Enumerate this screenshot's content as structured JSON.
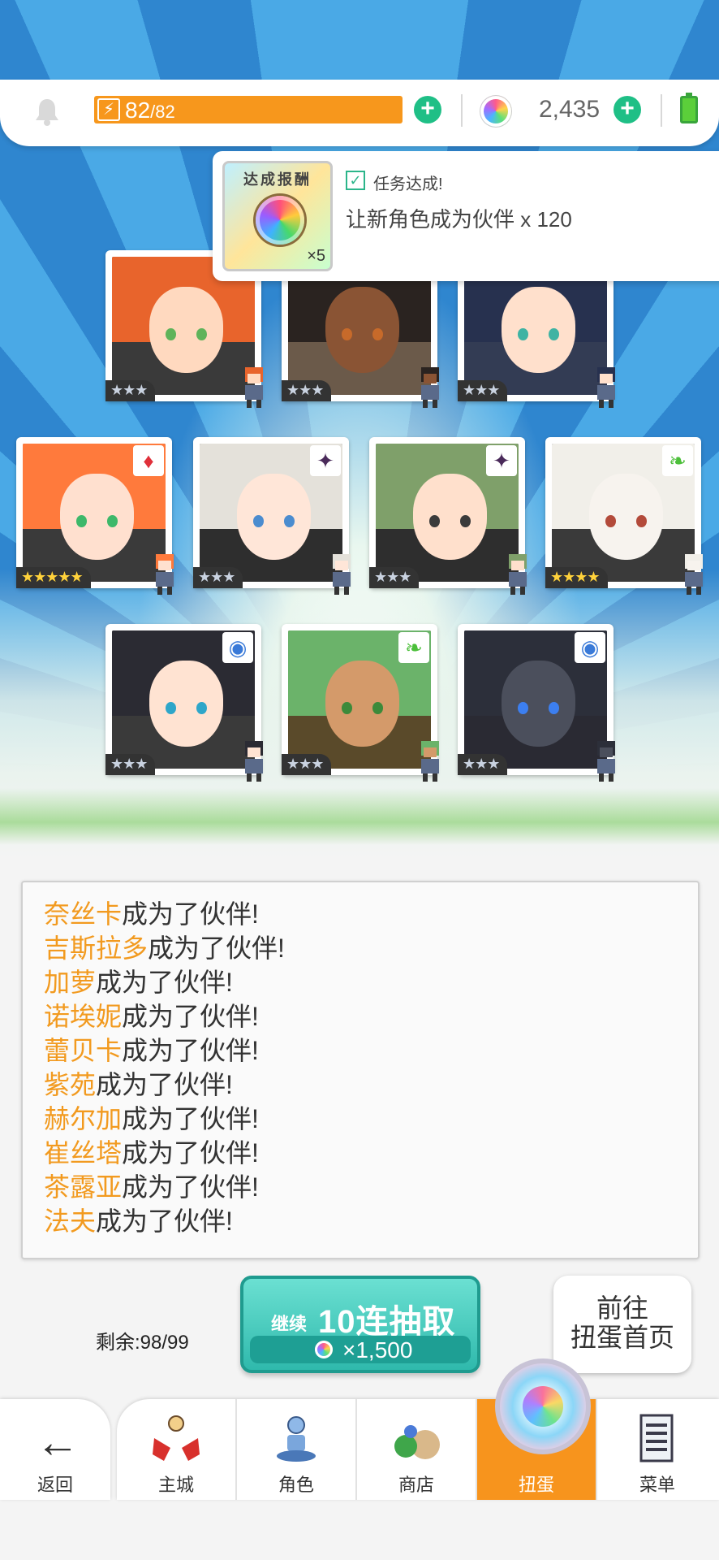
{
  "topbar": {
    "stamina_current": "82",
    "stamina_sep": "/",
    "stamina_max": "82",
    "stamina_fraction": 1.0,
    "gem_count": "2,435"
  },
  "popup": {
    "reward_title": "达成报酬",
    "reward_qty": "×5",
    "task_status": "任务达成!",
    "task_desc": "让新角色成为伙伴  x 120"
  },
  "cards": [
    {
      "stars": "★★★",
      "rarity": 3,
      "element": "",
      "hair": "#e8642c",
      "skin": "#ffd9bf",
      "eyes": "#5fb35a",
      "bg": "#3a3a3a"
    },
    {
      "stars": "★★★",
      "rarity": 3,
      "element": "",
      "hair": "#2a2320",
      "skin": "#8a5434",
      "eyes": "#c76a2a",
      "bg": "#6b5a4a"
    },
    {
      "stars": "★★★",
      "rarity": 3,
      "element": "",
      "hair": "#27314f",
      "skin": "#ffe0cc",
      "eyes": "#3fb3a3",
      "bg": "#333c54"
    },
    {
      "stars": "★★★★★",
      "rarity": 5,
      "element": "fire",
      "hair": "#ff7a3c",
      "skin": "#ffe0cf",
      "eyes": "#3db86a",
      "bg": "#3a3a3a"
    },
    {
      "stars": "★★★",
      "rarity": 3,
      "element": "dark",
      "hair": "#e4e1da",
      "skin": "#ffe6d8",
      "eyes": "#4b8ccf",
      "bg": "#2e2e2e"
    },
    {
      "stars": "★★★",
      "rarity": 3,
      "element": "dark",
      "hair": "#7fa06a",
      "skin": "#ffe0cc",
      "eyes": "#3b3b3b",
      "bg": "#2e2e2e"
    },
    {
      "stars": "★★★★",
      "rarity": 4,
      "element": "wind",
      "hair": "#f1efe9",
      "skin": "#f7f3ee",
      "eyes": "#b34a3a",
      "bg": "#3a3a3a"
    },
    {
      "stars": "★★★",
      "rarity": 3,
      "element": "water",
      "hair": "#2b2b33",
      "skin": "#ffe3d2",
      "eyes": "#2ea6c9",
      "bg": "#3a3a3a"
    },
    {
      "stars": "★★★",
      "rarity": 3,
      "element": "wind",
      "hair": "#6bb36a",
      "skin": "#d49a6a",
      "eyes": "#3b8a3a",
      "bg": "#5a4a2a"
    },
    {
      "stars": "★★★",
      "rarity": 3,
      "element": "water",
      "hair": "#2c2f3a",
      "skin": "#4b4f5c",
      "eyes": "#3c7ff0",
      "bg": "#2a2a33"
    }
  ],
  "log": [
    {
      "name": "奈丝卡",
      "suffix": "成为了伙伴!"
    },
    {
      "name": "吉斯拉多",
      "suffix": "成为了伙伴!"
    },
    {
      "name": "加萝",
      "suffix": "成为了伙伴!"
    },
    {
      "name": "诺埃妮",
      "suffix": "成为了伙伴!"
    },
    {
      "name": "蕾贝卡",
      "suffix": "成为了伙伴!"
    },
    {
      "name": "紫苑",
      "suffix": "成为了伙伴!"
    },
    {
      "name": "赫尔加",
      "suffix": "成为了伙伴!"
    },
    {
      "name": "崔丝塔",
      "suffix": "成为了伙伴!"
    },
    {
      "name": "茶露亚",
      "suffix": "成为了伙伴!"
    },
    {
      "name": "法夫",
      "suffix": "成为了伙伴!"
    }
  ],
  "controls": {
    "remaining": "剩余:98/99",
    "pull_continue": "继续",
    "pull_label": "10连抽取",
    "pull_cost": "×1,500",
    "home_line1": "前往",
    "home_line2": "扭蛋首页"
  },
  "nav": {
    "back": "返回",
    "items": [
      {
        "label": "主城",
        "icon": "castle-icon"
      },
      {
        "label": "角色",
        "icon": "character-icon"
      },
      {
        "label": "商店",
        "icon": "shop-icon"
      },
      {
        "label": "扭蛋",
        "icon": "gacha-icon",
        "active": true
      },
      {
        "label": "菜单",
        "icon": "menu-icon"
      }
    ]
  },
  "colors": {
    "accent_orange": "#f7941d",
    "accent_teal": "#2fb9ac",
    "name_highlight": "#f29a1f",
    "plus_green": "#1fbf86"
  }
}
